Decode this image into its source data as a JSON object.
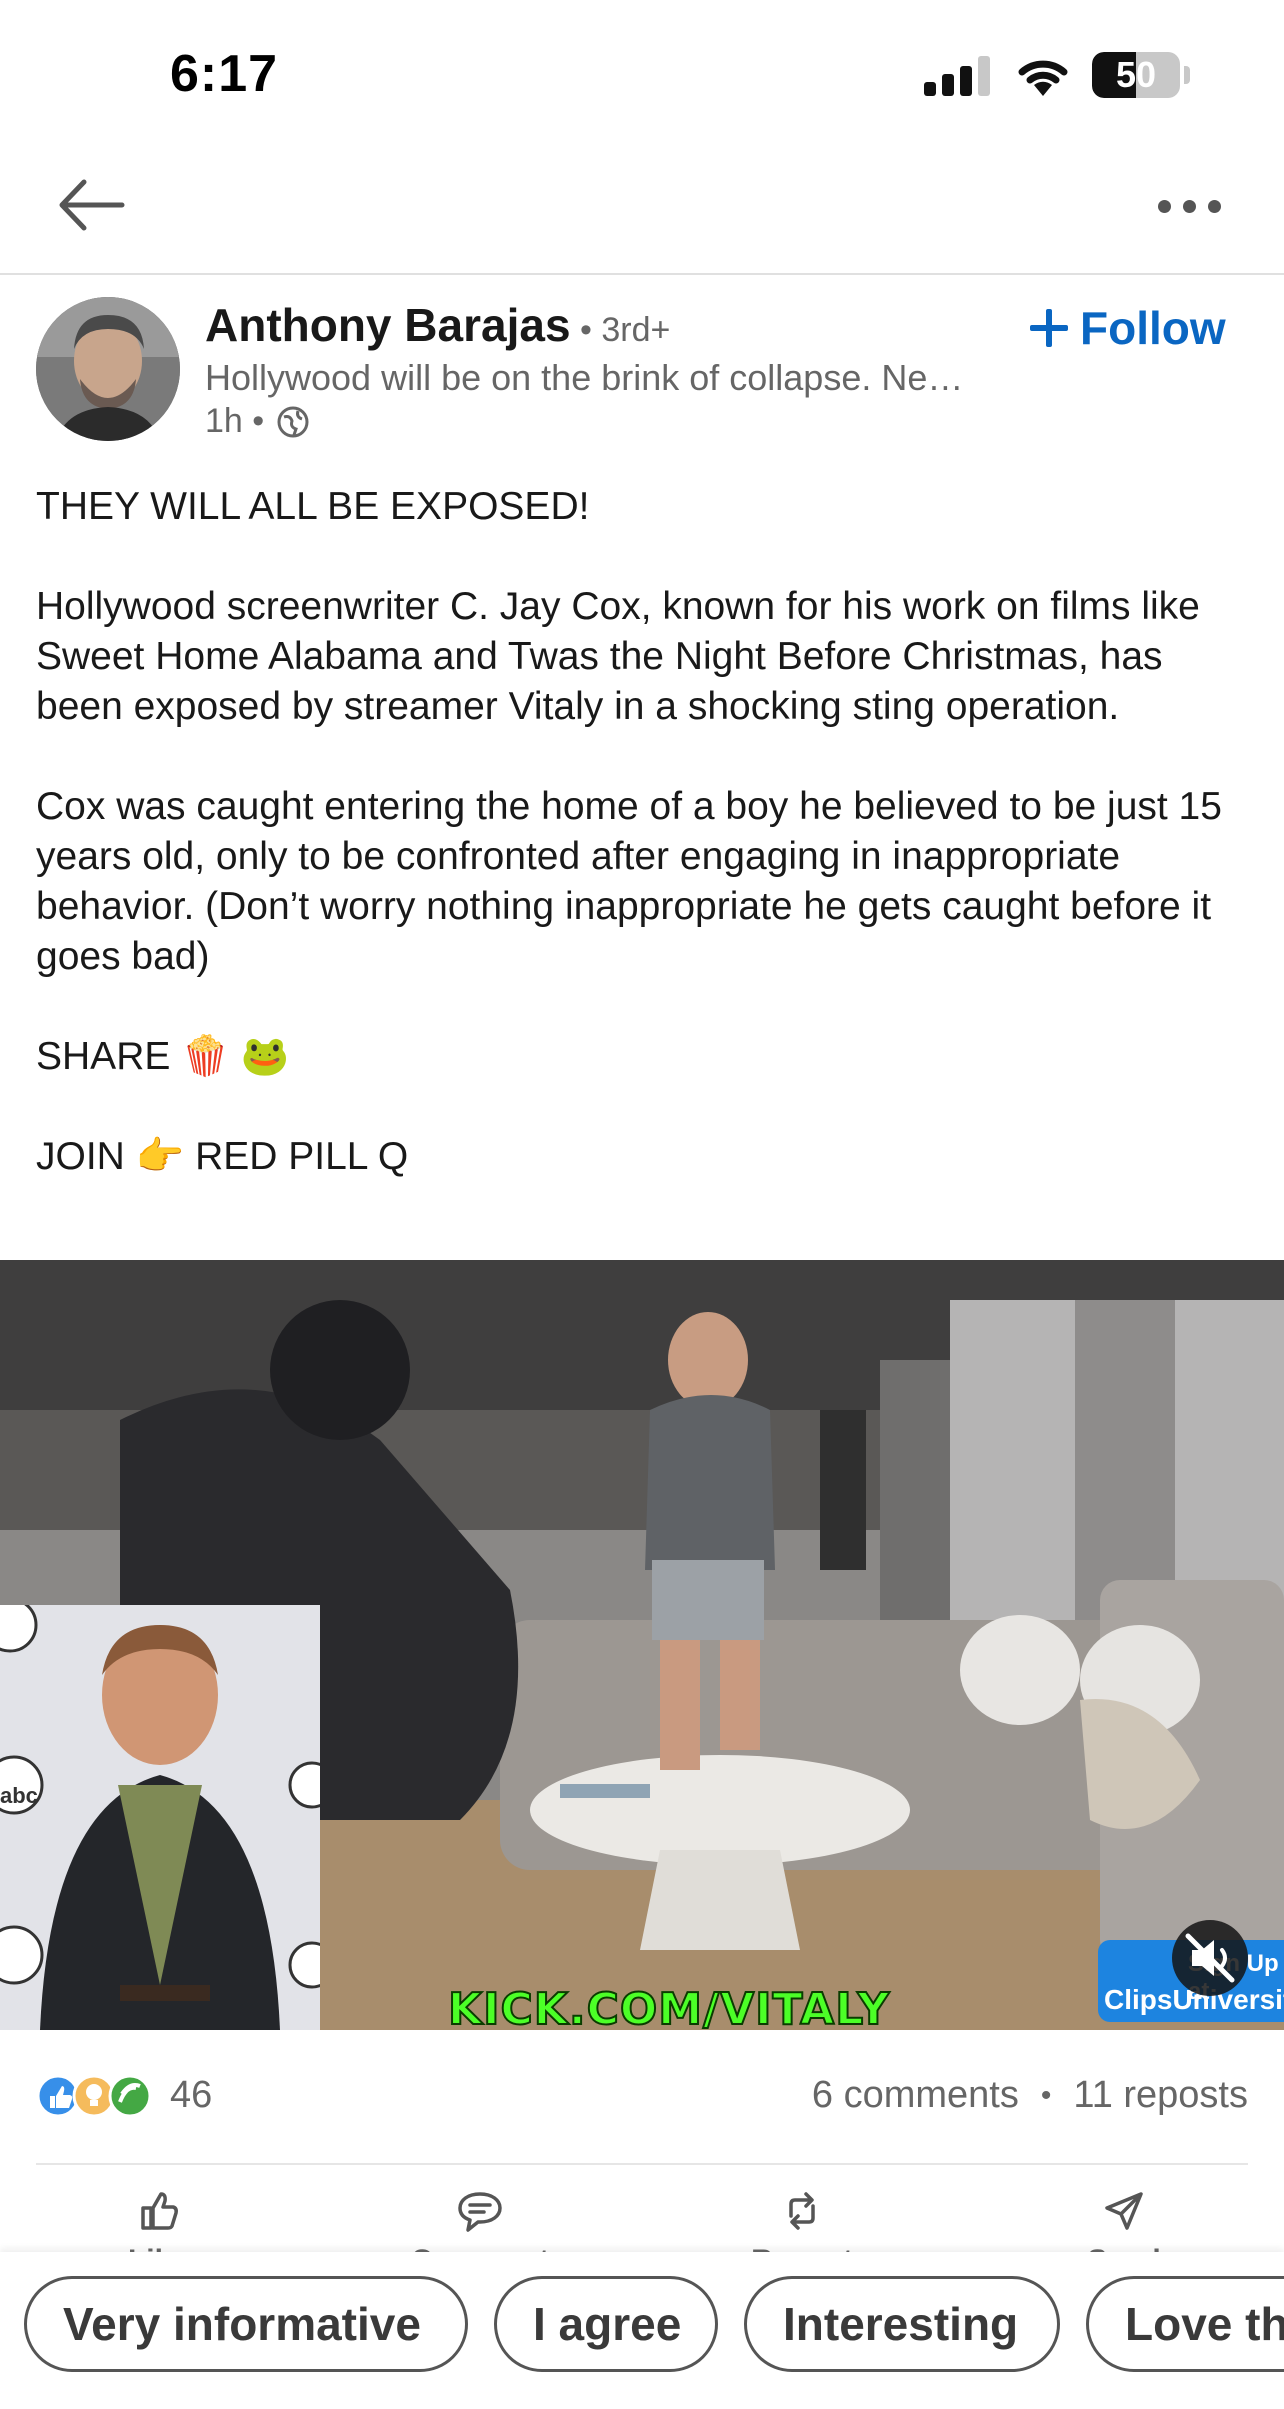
{
  "status_bar": {
    "time": "6:17",
    "battery_level": "50",
    "battery_fraction": 0.5,
    "signal_bars": 3,
    "icons": [
      "cellular-signal-icon",
      "wifi-icon",
      "battery-icon"
    ]
  },
  "nav": {
    "icons": [
      "back-arrow-icon",
      "more-options-icon"
    ]
  },
  "post": {
    "author": {
      "name": "Anthony Barajas",
      "degree": "• 3rd+",
      "headline": "Hollywood will be on the brink of collapse. Ne…",
      "time": "1h •",
      "visibility_icon": "globe-icon"
    },
    "follow_label": "Follow",
    "text": {
      "p1": "THEY WILL ALL BE EXPOSED!",
      "p2": "Hollywood screenwriter C. Jay Cox, known for his work on films like Sweet Home Alabama and Twas the Night Before Christmas, has been exposed by streamer Vitaly in a shocking sting operation.",
      "p3": "Cox was caught entering the home of a boy he believed to be just 15 years old, only to be confronted after engaging in inappropriate behavior. (Don’t worry nothing inappropriate he gets caught before it goes bad)",
      "p4": "SHARE 🍿 🐸",
      "p5": "JOIN 👉 RED PILL Q"
    },
    "video": {
      "overlay_text": "KICK.COM/VITALY",
      "watermark_top": "Sign Up at",
      "watermark_bottom": "ClipsUniversity",
      "inset_logo_text": "abc",
      "mute_icon": "muted-speaker-icon"
    },
    "social": {
      "reaction_icons": [
        "like-reaction-icon",
        "insightful-reaction-icon",
        "celebrate-reaction-icon"
      ],
      "reaction_count": "46",
      "comments": "6 comments",
      "separator": "•",
      "reposts": "11 reposts"
    },
    "actions": [
      {
        "label": "Like",
        "icon": "thumbs-up-icon"
      },
      {
        "label": "Comment",
        "icon": "comment-icon"
      },
      {
        "label": "Repost",
        "icon": "repost-icon"
      },
      {
        "label": "Send",
        "icon": "send-icon"
      }
    ],
    "suggestion_chips": [
      "Very informative",
      "I agree",
      "Interesting",
      "Love this"
    ]
  },
  "colors": {
    "linkedin_blue": "#0a66c2",
    "text_primary": "#191919",
    "text_secondary": "#666666",
    "kick_green": "#4cff27"
  }
}
